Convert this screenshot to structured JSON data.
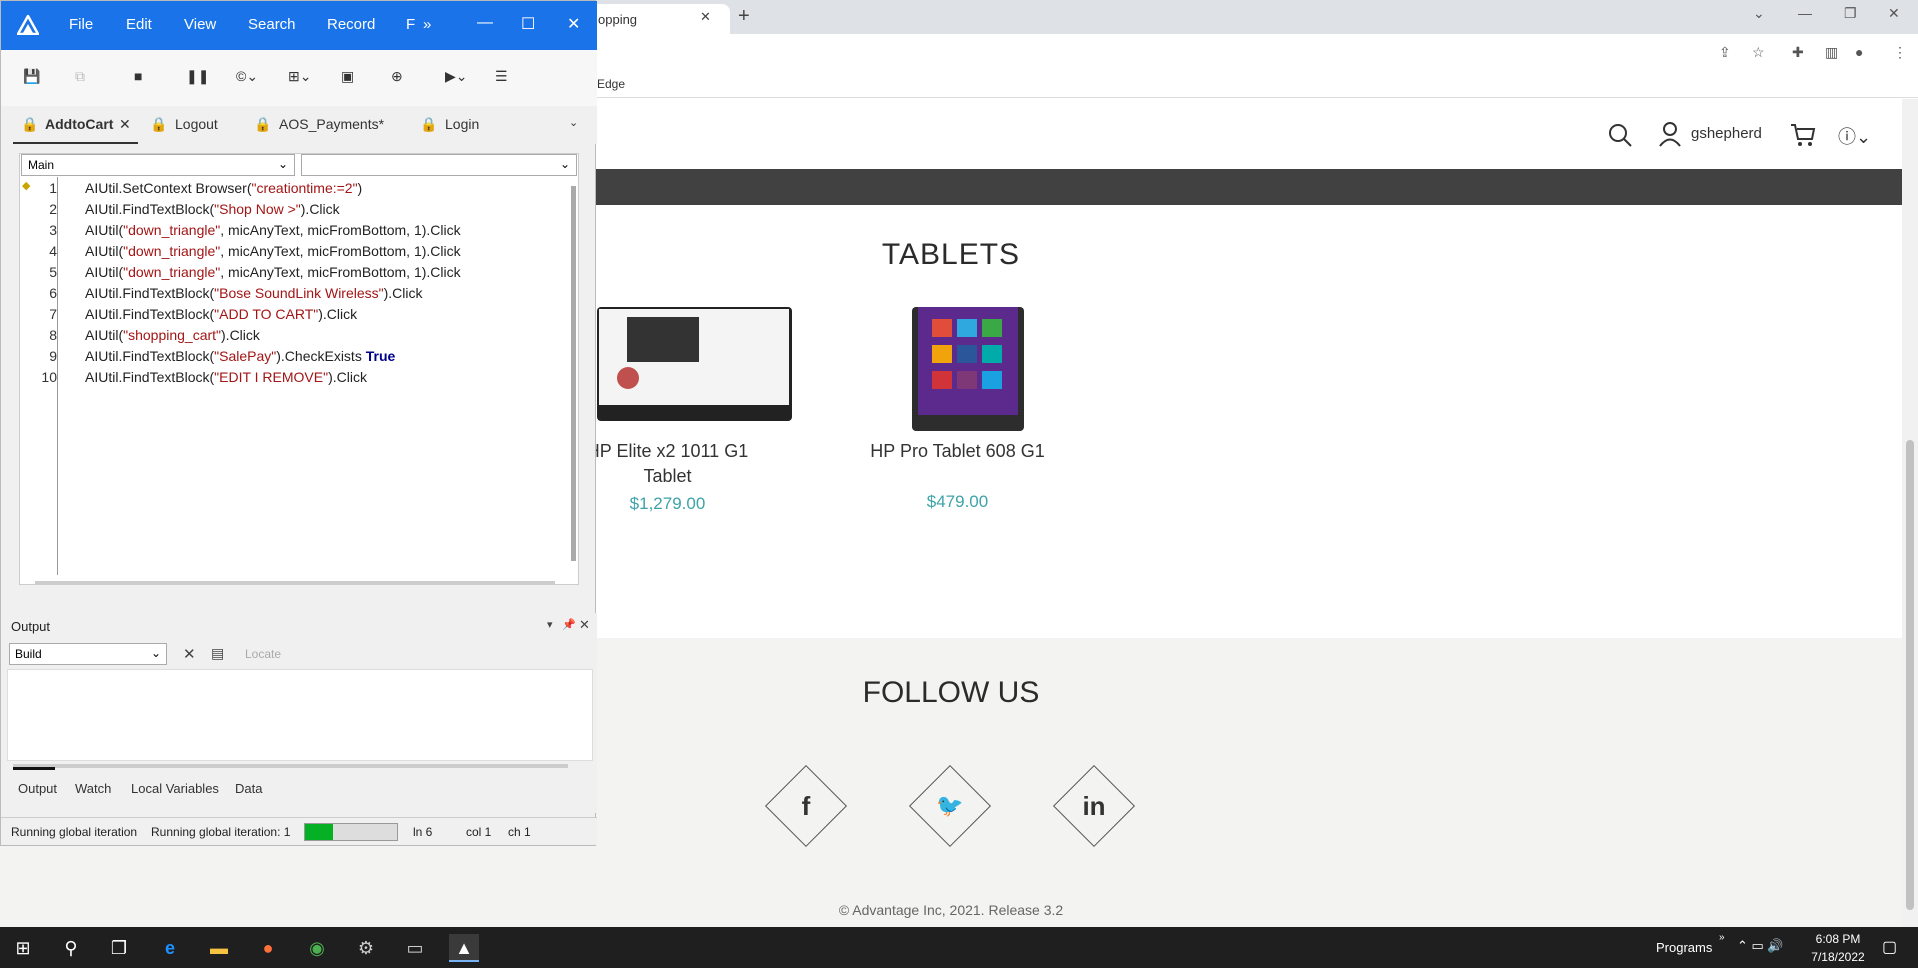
{
  "browser": {
    "tab_title": "opping",
    "bookmark": "Edge",
    "username": "gshepherd"
  },
  "site": {
    "section_title": "TABLETS",
    "products": [
      {
        "name_line1": "HP Elite x2 1011 G1",
        "name_line2": "Tablet",
        "price": "$1,279.00"
      },
      {
        "name_line1": "HP Pro Tablet 608 G1",
        "name_line2": "",
        "price": "$479.00"
      }
    ],
    "follow_title": "FOLLOW US",
    "social": {
      "facebook": "f",
      "twitter": "🐦",
      "linkedin": "in"
    },
    "copyright": "© Advantage Inc, 2021. Release 3.2"
  },
  "uft": {
    "menu": [
      "File",
      "Edit",
      "View",
      "Search",
      "Record",
      "F"
    ],
    "doc_tabs": [
      "AddtoCart",
      "Logout",
      "AOS_Payments*",
      "Login"
    ],
    "combo_left": "Main",
    "combo_right": "",
    "code_lines": [
      "AIUtil.SetContext Browser(\"creationtime:=2\")",
      "AIUtil.FindTextBlock(\"Shop Now >\").Click",
      "AIUtil(\"down_triangle\", micAnyText, micFromBottom, 1).Click",
      "AIUtil(\"down_triangle\", micAnyText, micFromBottom, 1).Click",
      "AIUtil(\"down_triangle\", micAnyText, micFromBottom, 1).Click",
      "AIUtil.FindTextBlock(\"Bose SoundLink Wireless\").Click",
      "AIUtil.FindTextBlock(\"ADD TO CART\").Click",
      "AIUtil(\"shopping_cart\").Click",
      "AIUtil.FindTextBlock(\"SalePay\").CheckExists True",
      "AIUtil.FindTextBlock(\"EDIT I REMOVE\").Click"
    ],
    "line_numbers": [
      "1",
      "2",
      "3",
      "4",
      "5",
      "6",
      "7",
      "8",
      "9",
      "10"
    ],
    "output_title": "Output",
    "output_select": "Build",
    "locate_label": "Locate",
    "bottom_tabs": [
      "Output",
      "Watch",
      "Local Variables",
      "Data"
    ],
    "status": {
      "left": "Running global iteration",
      "iteration": "Running global iteration: 1",
      "progress": 0.3,
      "ln": "ln 6",
      "col": "col 1",
      "ch": "ch 1"
    }
  },
  "taskbar": {
    "programs": "Programs",
    "time": "6:08 PM",
    "date": "7/18/2022"
  }
}
